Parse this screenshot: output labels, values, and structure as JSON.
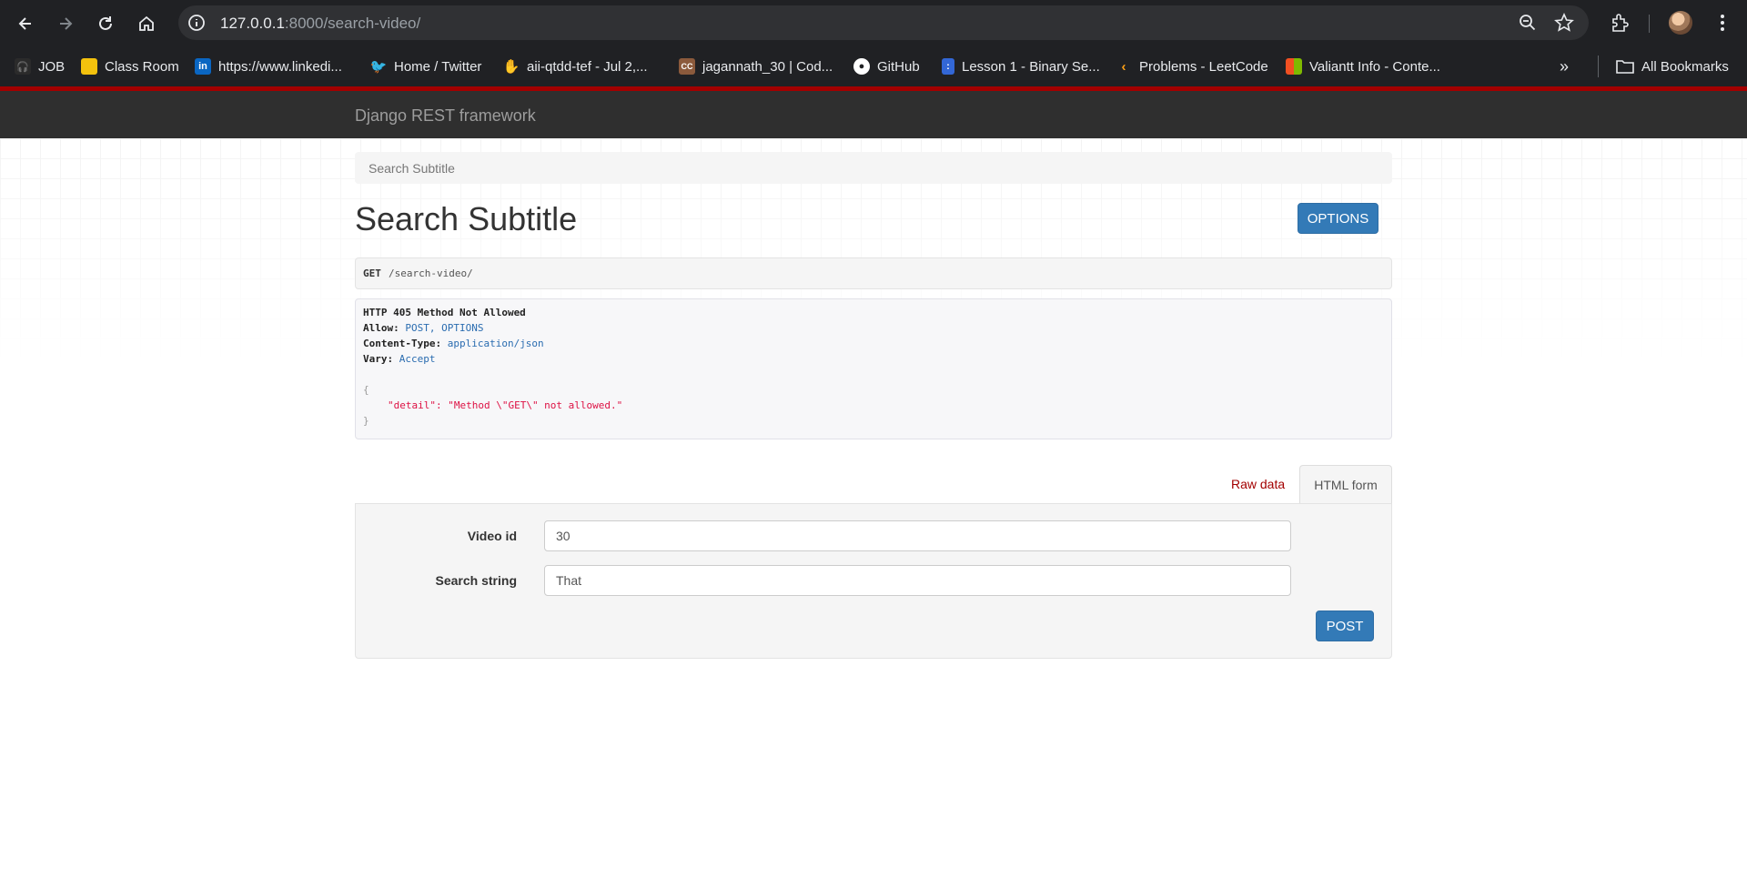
{
  "browser": {
    "url_host": "127.0.0.1",
    "url_rest": ":8000/search-video/"
  },
  "bookmarks": [
    {
      "label": "JOB",
      "icon": "headset-icon",
      "color": "#f4b400"
    },
    {
      "label": "Class Room",
      "icon": "classroom-icon",
      "color": "#f4c20d"
    },
    {
      "label": "https://www.linkedi...",
      "icon": "linkedin-icon",
      "color": "#0a66c2"
    },
    {
      "label": "Home / Twitter",
      "icon": "twitter-icon",
      "color": "#1d9bf0"
    },
    {
      "label": "aii-qtdd-tef - Jul 2,...",
      "icon": "meet-icon",
      "color": "#fbbc04"
    },
    {
      "label": "jagannath_30 | Cod...",
      "icon": "codechef-icon",
      "color": "#8b5a3c"
    },
    {
      "label": "GitHub",
      "icon": "github-icon",
      "color": "#ffffff"
    },
    {
      "label": "Lesson 1 - Binary Se...",
      "icon": "codility-icon",
      "color": "#3367d6"
    },
    {
      "label": "Problems - LeetCode",
      "icon": "leetcode-icon",
      "color": "#ffa116"
    },
    {
      "label": "Valiantt Info - Conte...",
      "icon": "microsoft-icon",
      "color": "#f25022"
    }
  ],
  "all_bookmarks_label": "All Bookmarks",
  "drf": {
    "brand": "Django REST framework",
    "breadcrumb": "Search Subtitle",
    "title": "Search Subtitle",
    "options_label": "OPTIONS",
    "request_method": "GET",
    "request_path": "/search-video/",
    "response": {
      "status_line": "HTTP 405 Method Not Allowed",
      "allow_key": "Allow:",
      "allow_value": "POST, OPTIONS",
      "ctype_key": "Content-Type:",
      "ctype_value": "application/json",
      "vary_key": "Vary:",
      "vary_value": "Accept",
      "brace_open": "{",
      "body_line": "\"detail\": \"Method \\\"GET\\\" not allowed.\"",
      "brace_close": "}"
    },
    "tabs": {
      "raw": "Raw data",
      "html": "HTML form"
    },
    "form": {
      "video_id_label": "Video id",
      "video_id_value": "30",
      "search_label": "Search string",
      "search_value": "That",
      "post_label": "POST"
    }
  },
  "colors": {
    "drf_red": "#a30000",
    "primary": "#337ab7"
  }
}
